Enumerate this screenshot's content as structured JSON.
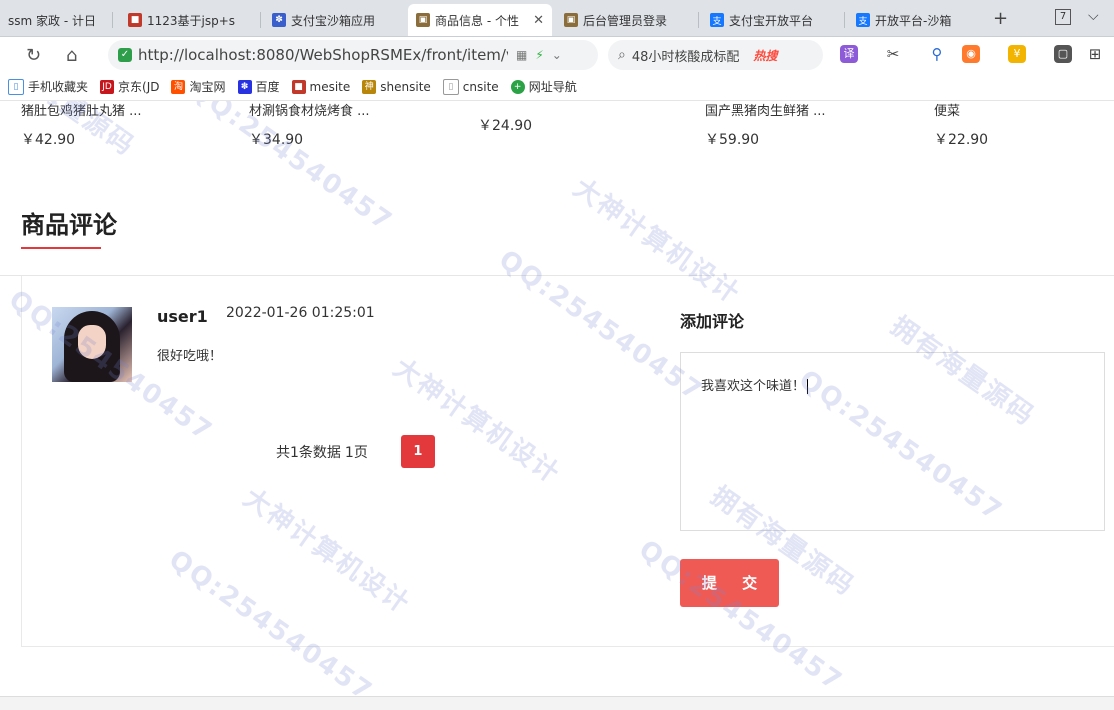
{
  "browser": {
    "tabs": [
      {
        "label": "ssm 家政 - 计日",
        "color": "#6c7a89",
        "active": false
      },
      {
        "label": "1123基于jsp+s",
        "color": "#c0392b",
        "active": false
      },
      {
        "label": "支付宝沙箱应用",
        "color": "#3a5fcd",
        "active": false
      },
      {
        "label": "商品信息 - 个性",
        "color": "#8a6d3b",
        "active": true
      },
      {
        "label": "后台管理员登录",
        "color": "#8a6d3b",
        "active": false
      },
      {
        "label": "支付宝开放平台",
        "color": "#1677ff",
        "active": false
      },
      {
        "label": "开放平台-沙箱",
        "color": "#1677ff",
        "active": false
      }
    ],
    "tab_count": "7",
    "url": "http://localhost:8080/WebShopRSMEx/front/item/view",
    "search_text": "48小时核酸成标配",
    "hot_label": "热搜",
    "bookmarks": [
      "手机收藏夹",
      "京东(JD",
      "淘宝网",
      "百度",
      "mesite",
      "shensite",
      "cnsite",
      "网址导航"
    ]
  },
  "products": [
    {
      "title2": "猪肚包鸡猪肚丸猪 ...",
      "price": "￥42.90"
    },
    {
      "title2": "材涮锅食材烧烤食 ...",
      "price": "￥34.90"
    },
    {
      "title2": "",
      "price": "￥24.90"
    },
    {
      "title2": "国产黑猪肉生鲜猪 ...",
      "price": "￥59.90"
    },
    {
      "title2": "便菜",
      "price": "￥22.90"
    }
  ],
  "reviews": {
    "section_title": "商品评论",
    "items": [
      {
        "user": "user1",
        "time": "2022-01-26 01:25:01",
        "text": "很好吃哦！"
      }
    ],
    "pager": {
      "total": "共1条数据",
      "pages": "1页",
      "current": "1"
    }
  },
  "add_review": {
    "title": "添加评论",
    "text": "我喜欢这个味道！",
    "submit": "提 交"
  },
  "watermark": {
    "texts": [
      "大神计算机设计",
      "QQ:254540457",
      "拥有海量源码"
    ]
  },
  "colors": {
    "accent": "#e4393c",
    "submit": "#f05a55"
  }
}
